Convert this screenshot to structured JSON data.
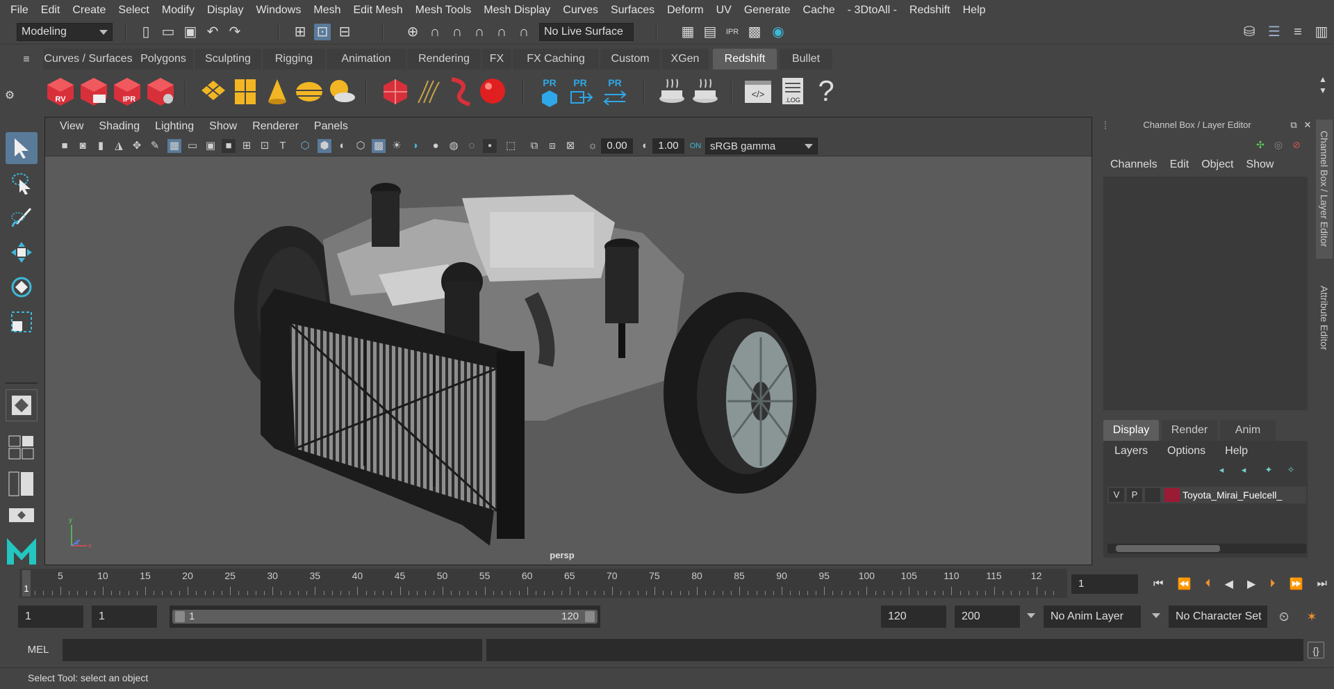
{
  "menubar": {
    "items": [
      "File",
      "Edit",
      "Create",
      "Select",
      "Modify",
      "Display",
      "Windows",
      "Mesh",
      "Edit Mesh",
      "Mesh Tools",
      "Mesh Display",
      "Curves",
      "Surfaces",
      "Deform",
      "UV",
      "Generate",
      "Cache",
      "- 3DtoAll -",
      "Redshift",
      "Help"
    ]
  },
  "statusline": {
    "mode": "Modeling",
    "live_surface": "No Live Surface"
  },
  "shelf": {
    "tabs": [
      "Curves / Surfaces",
      "Polygons",
      "Sculpting",
      "Rigging",
      "Animation",
      "Rendering",
      "FX",
      "FX Caching",
      "Custom",
      "XGen",
      "Redshift",
      "Bullet"
    ],
    "active_tab": "Redshift",
    "icon_labels": {
      "rv": "RV",
      "ipr": "IPR",
      "pr": "PR",
      "log": ".LOG",
      "help": "?"
    }
  },
  "viewport": {
    "menus": [
      "View",
      "Shading",
      "Lighting",
      "Show",
      "Renderer",
      "Panels"
    ],
    "exposure": "0.00",
    "gamma": "1.00",
    "color_space": "sRGB gamma",
    "camera_label": "persp",
    "axis_labels": {
      "y": "y",
      "x": "x",
      "z": "z"
    }
  },
  "channelbox": {
    "title": "Channel Box / Layer Editor",
    "menus": [
      "Channels",
      "Edit",
      "Object",
      "Show"
    ],
    "layer_tabs": [
      "Display",
      "Render",
      "Anim"
    ],
    "active_layer_tab": "Display",
    "layer_menus": [
      "Layers",
      "Options",
      "Help"
    ],
    "layer": {
      "v": "V",
      "p": "P",
      "name": "Toyota_Mirai_Fuelcell_",
      "color": "#9b1a34"
    }
  },
  "sidetabs": {
    "tabs": [
      "Channel Box / Layer Editor",
      "Attribute Editor"
    ]
  },
  "timeslider": {
    "ticks": [
      "5",
      "10",
      "15",
      "20",
      "25",
      "30",
      "35",
      "40",
      "45",
      "50",
      "55",
      "60",
      "65",
      "70",
      "75",
      "80",
      "85",
      "90",
      "95",
      "100",
      "105",
      "110",
      "115",
      "12"
    ],
    "current_marker": "1",
    "current_frame": "1"
  },
  "range": {
    "start": "1",
    "playback_start": "1",
    "range_start_label": "1",
    "range_end_label": "120",
    "playback_end": "120",
    "end": "200",
    "anim_layer": "No Anim Layer",
    "character_set": "No Character Set"
  },
  "cmdline": {
    "label": "MEL"
  },
  "helpline": {
    "text": "Select Tool: select an object"
  }
}
